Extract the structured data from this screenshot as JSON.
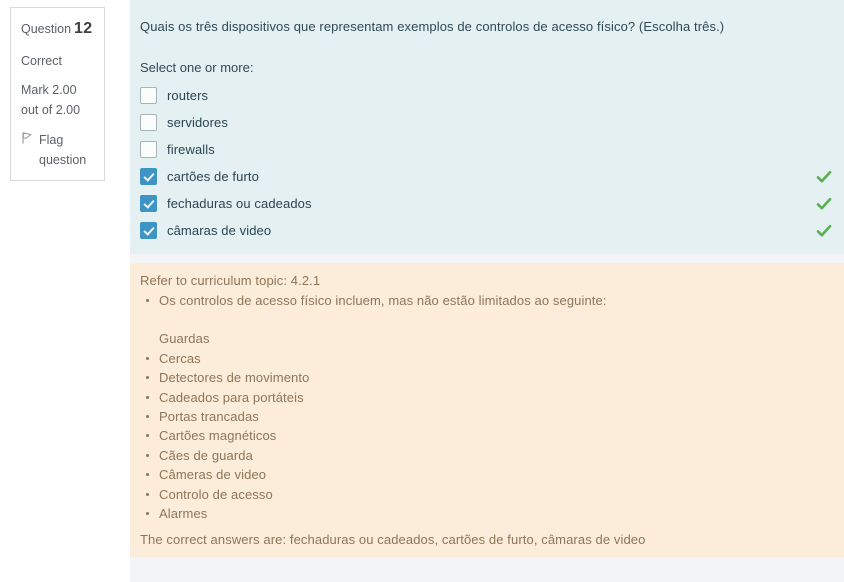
{
  "sidebar": {
    "question_word": "Question",
    "question_number": "12",
    "status": "Correct",
    "mark": "Mark 2.00 out of 2.00",
    "flag_label": "Flag question",
    "flag_icon": "flag-icon"
  },
  "question": {
    "text": "Quais os três dispositivos que representam exemplos de controlos de acesso físico? (Escolha três.)",
    "select_instruction": "Select one or more:",
    "options": [
      {
        "label": "routers",
        "checked": false,
        "correct_marker": false
      },
      {
        "label": "servidores",
        "checked": false,
        "correct_marker": false
      },
      {
        "label": "firewalls",
        "checked": false,
        "correct_marker": false
      },
      {
        "label": "cartões de furto",
        "checked": true,
        "correct_marker": true
      },
      {
        "label": "fechaduras ou cadeados",
        "checked": true,
        "correct_marker": true
      },
      {
        "label": "câmaras de video",
        "checked": true,
        "correct_marker": true
      }
    ],
    "correct_marker_icon": "green-check-icon"
  },
  "feedback": {
    "topic": "Refer to curriculum topic: 4.2.1",
    "items": [
      {
        "text": "Os controlos de acesso físico incluem, mas não estão limitados ao seguinte:",
        "bullet": true
      },
      {
        "text": "",
        "bullet": false,
        "spacer": true
      },
      {
        "text": "Guardas",
        "bullet": false
      },
      {
        "text": "Cercas",
        "bullet": true
      },
      {
        "text": "Detectores de movimento",
        "bullet": true
      },
      {
        "text": "Cadeados para portáteis",
        "bullet": true
      },
      {
        "text": "Portas trancadas",
        "bullet": true
      },
      {
        "text": "Cartões magnéticos",
        "bullet": true
      },
      {
        "text": "Cães de guarda",
        "bullet": true
      },
      {
        "text": "Câmeras de video",
        "bullet": true
      },
      {
        "text": "Controlo de acesso",
        "bullet": true
      },
      {
        "text": "Alarmes",
        "bullet": true
      }
    ],
    "correct_answers": "The correct answers are: fechaduras ou cadeados, cartões de furto, câmaras de video"
  },
  "colors": {
    "question_bg": "#e4f0f2",
    "feedback_bg": "#fcecda",
    "checkbox_checked": "#3e94c4",
    "correct_check": "#57b14d",
    "feedback_text": "#8f7558",
    "divider": "#f3f4f5"
  }
}
